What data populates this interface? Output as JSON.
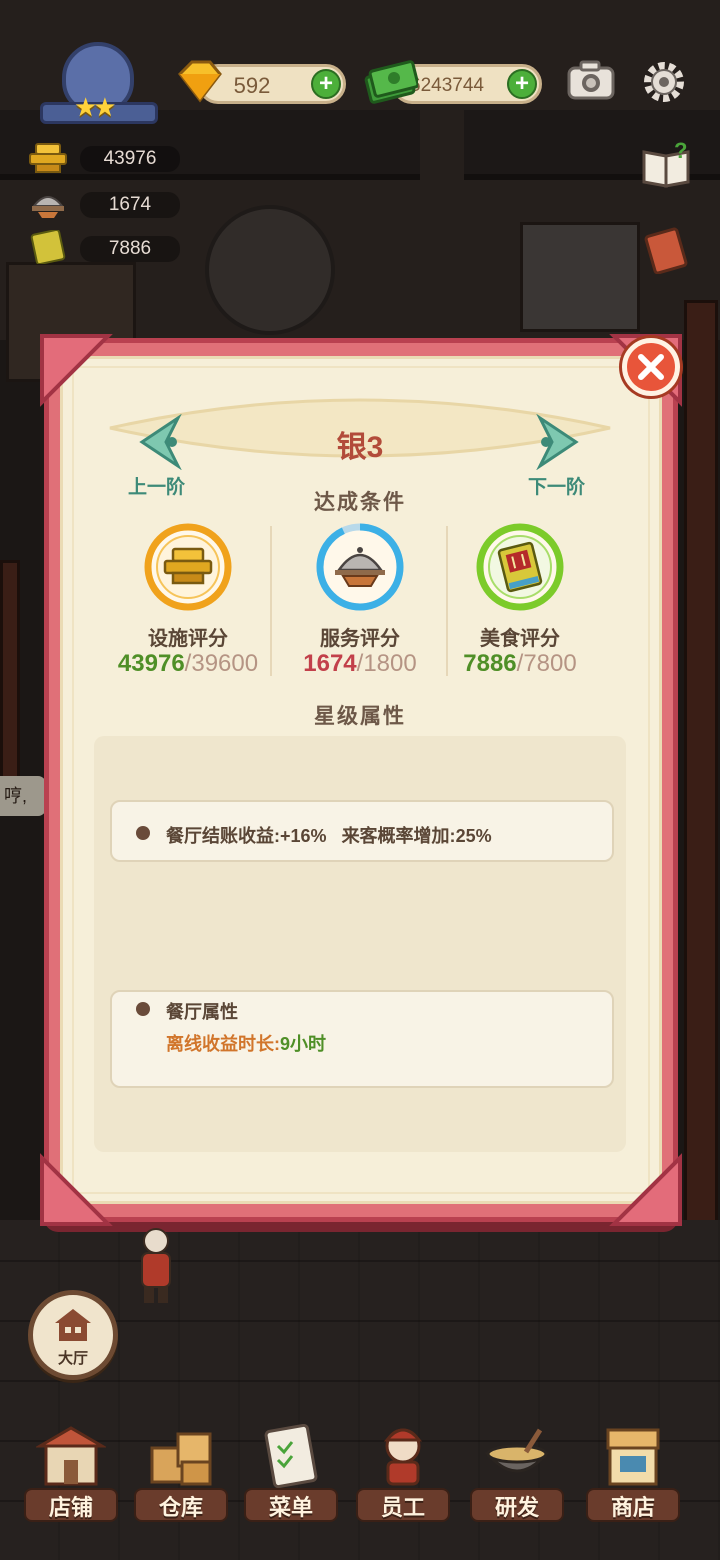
{
  "hud": {
    "gems": "592",
    "cash": "6243744",
    "rank_stars": "★★"
  },
  "scores": {
    "facility": "43976",
    "service": "1674",
    "food": "7886"
  },
  "background": {
    "speech_text": "哼,"
  },
  "modal": {
    "title": "银3",
    "prev_label": "上一阶",
    "next_label": "下一阶",
    "conditions_heading": "达成条件",
    "conditions": [
      {
        "label": "设施评分",
        "current": "43976",
        "required": "/39600",
        "met": true,
        "color": "#f0a21c",
        "icon": "bell-counter-icon"
      },
      {
        "label": "服务评分",
        "current": "1674",
        "required": "/1800",
        "met": false,
        "color": "#3cb0e6",
        "icon": "serving-tray-icon",
        "progress": 0.93
      },
      {
        "label": "美食评分",
        "current": "7886",
        "required": "/7800",
        "met": true,
        "color": "#7ccb2a",
        "icon": "recipe-book-icon"
      }
    ],
    "attributes_heading": "星级属性",
    "bonus": {
      "checkout_label": "餐厅结账收益:",
      "checkout_value": "+16%",
      "visitor_label": "来客概率增加:",
      "visitor_value": "25%"
    },
    "restaurant_attr": {
      "heading": "餐厅属性",
      "offline_label": "离线收益时长:",
      "offline_value": "9小时"
    }
  },
  "hall_button_label": "大厅",
  "nav": [
    {
      "label": "店铺",
      "icon": "shop-building-icon"
    },
    {
      "label": "仓库",
      "icon": "warehouse-boxes-icon"
    },
    {
      "label": "菜单",
      "icon": "menu-clipboard-icon"
    },
    {
      "label": "员工",
      "icon": "staff-chef-icon"
    },
    {
      "label": "研发",
      "icon": "research-wok-icon"
    },
    {
      "label": "商店",
      "icon": "store-stall-icon"
    }
  ]
}
